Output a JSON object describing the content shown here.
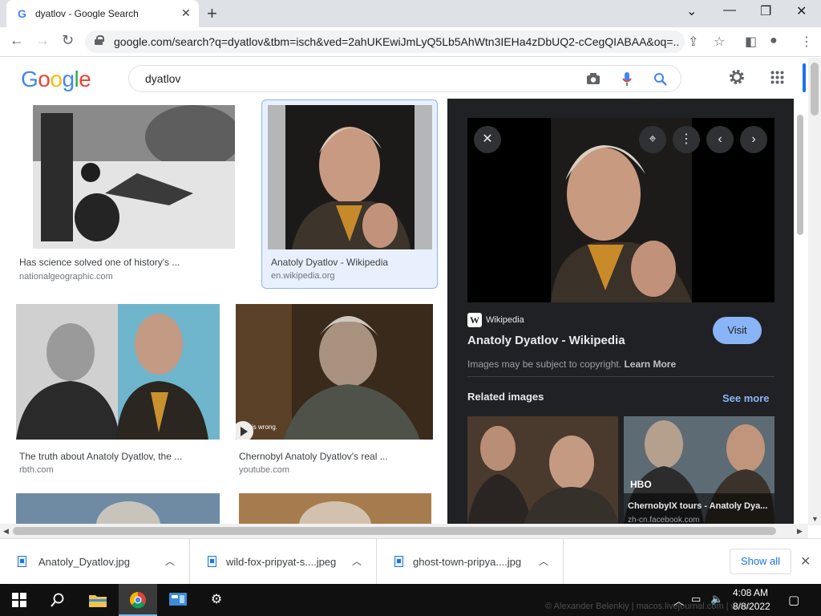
{
  "browser": {
    "tab_title": "dyatlov - Google Search",
    "tab_favicon": "G",
    "url": "google.com/search?q=dyatlov&tbm=isch&ved=2ahUKEwiJmLyQ5Lb5AhWtn3IEHa4zDbUQ2-cCegQIABAA&oq=...",
    "window_controls": {
      "minimize": "—",
      "restore": "❐",
      "close": "✕",
      "tab_list": "⌄"
    }
  },
  "header": {
    "logo": [
      "G",
      "o",
      "o",
      "g",
      "l",
      "e"
    ],
    "logo_colors": [
      "#4285f4",
      "#ea4335",
      "#fbbc05",
      "#4285f4",
      "#34a853",
      "#ea4335"
    ],
    "search_query": "dyatlov",
    "icons": [
      "camera-icon",
      "microphone-icon",
      "search-icon",
      "settings-gear-icon",
      "apps-grid-icon"
    ]
  },
  "results": [
    {
      "caption": "Has science solved one of history's ...",
      "source": "nationalgeographic.com"
    },
    {
      "caption": "Anatoly Dyatlov - Wikipedia",
      "source": "en.wikipedia.org",
      "selected": true
    },
    {
      "caption": "The truth about Anatoly Dyatlov, the ...",
      "source": "rbth.com"
    },
    {
      "caption": "Chernobyl Anatoly Dyatlov's real ...",
      "source": "youtube.com",
      "overlay": "is wrong."
    }
  ],
  "preview": {
    "source_badge": "W",
    "source_name": "Wikipedia",
    "title": "Anatoly Dyatlov - Wikipedia",
    "visit_label": "Visit",
    "copyright": "Images may be subject to copyright.",
    "learn_more": "Learn More",
    "related_heading": "Related images",
    "see_more": "See more",
    "related": [
      {
        "caption": "",
        "source": ""
      },
      {
        "caption": "ChernobylX tours - Anatoly Dya...",
        "source": "zh-cn.facebook.com",
        "badge": "HBO"
      }
    ]
  },
  "downloads": {
    "items": [
      "Anatoly_Dyatlov.jpg",
      "wild-fox-pripyat-s....jpeg",
      "ghost-town-pripya....jpg"
    ],
    "show_all": "Show all"
  },
  "taskbar": {
    "time": "4:08 AM",
    "date": "8/8/2022",
    "watermark": "© Alexander Belenkiy | macos.livejournal.com | www."
  },
  "colors": {
    "accent": "#1a73e8",
    "panel_bg": "#202124",
    "visit_button": "#8ab4f8"
  }
}
